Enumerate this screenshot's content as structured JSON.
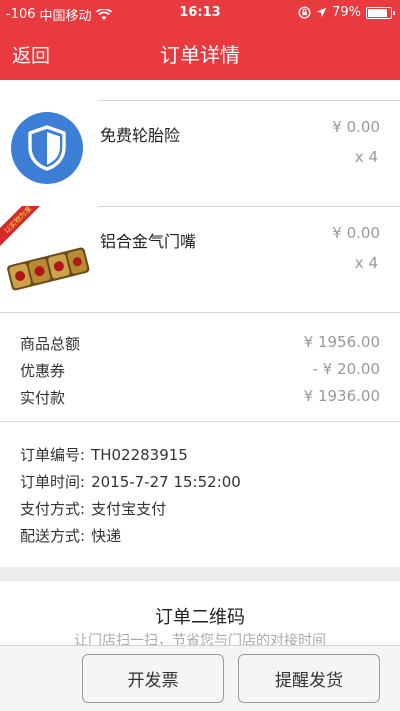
{
  "status_bar": {
    "signal": "-106",
    "carrier": "中国移动",
    "time": "16:13",
    "battery": "79%",
    "battery_level": 0.79
  },
  "nav": {
    "back_label": "返回",
    "title": "订单详情"
  },
  "items": [
    {
      "name": "免费轮胎险",
      "price": "¥ 0.00",
      "qty": "x 4",
      "icon": "shield-icon"
    },
    {
      "name": "铝合金气门嘴",
      "price": "¥ 0.00",
      "qty": "x 4",
      "icon": "valve-product-image",
      "badge": "以实物为准"
    }
  ],
  "summary": [
    {
      "label": "商品总额",
      "value": "¥ 1956.00"
    },
    {
      "label": "优惠券",
      "value": "- ¥ 20.00"
    },
    {
      "label": "实付款",
      "value": "¥ 1936.00"
    }
  ],
  "order_info": [
    {
      "label": "订单编号:",
      "value": "TH02283915"
    },
    {
      "label": "订单时间:",
      "value": "2015-7-27 15:52:00"
    },
    {
      "label": "支付方式:",
      "value": "支付宝支付"
    },
    {
      "label": "配送方式:",
      "value": "快递"
    }
  ],
  "qr": {
    "title": "订单二维码",
    "subtitle": "让门店扫一扫，节省您与门店的对接时间"
  },
  "buttons": {
    "invoice": "开发票",
    "remind": "提醒发货"
  },
  "colors": {
    "accent": "#e83a3f",
    "shield": "#3d7ed6"
  }
}
